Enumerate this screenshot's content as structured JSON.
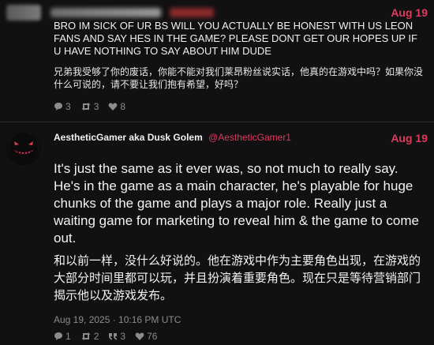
{
  "post1": {
    "date": "Aug 19",
    "text": "BRO IM SICK OF UR BS WILL YOU ACTUALLY BE HONEST WITH US LEON FANS AND SAY HES IN THE GAME? PLEASE DONT GET OUR HOPES UP IF U HAVE NOTHING TO SAY ABOUT HIM DUDE",
    "translation": "兄弟我受够了你的废话，你能不能对我们莱昂粉丝说实话，他真的在游戏中吗？如果你没什么可说的，请不要让我们抱有希望，好吗？",
    "actions": {
      "replies": "3",
      "retweets": "3",
      "likes": "8"
    }
  },
  "post2": {
    "author": "AestheticGamer aka Dusk Golem",
    "handle": "@AestheticGamer1",
    "date": "Aug 19",
    "text": "It's just the same as it ever was, so not much to really say. He's in the game as a main character, he's playable for huge chunks of the game and plays a major role. Really just a waiting game for marketing to reveal him & the game to come out.",
    "translation": "和以前一样，没什么好说的。他在游戏中作为主要角色出现，在游戏的大部分时间里都可以玩，并且扮演着重要角色。现在只是等待营销部门揭示他以及游戏发布。",
    "timestamp": "Aug 19, 2025 · 10:16 PM UTC",
    "actions": {
      "replies": "1",
      "retweets": "2",
      "quotes": "3",
      "likes": "76"
    }
  },
  "colors": {
    "accent": "#e0395e",
    "background": "#111111",
    "muted": "#8c8c8c"
  }
}
